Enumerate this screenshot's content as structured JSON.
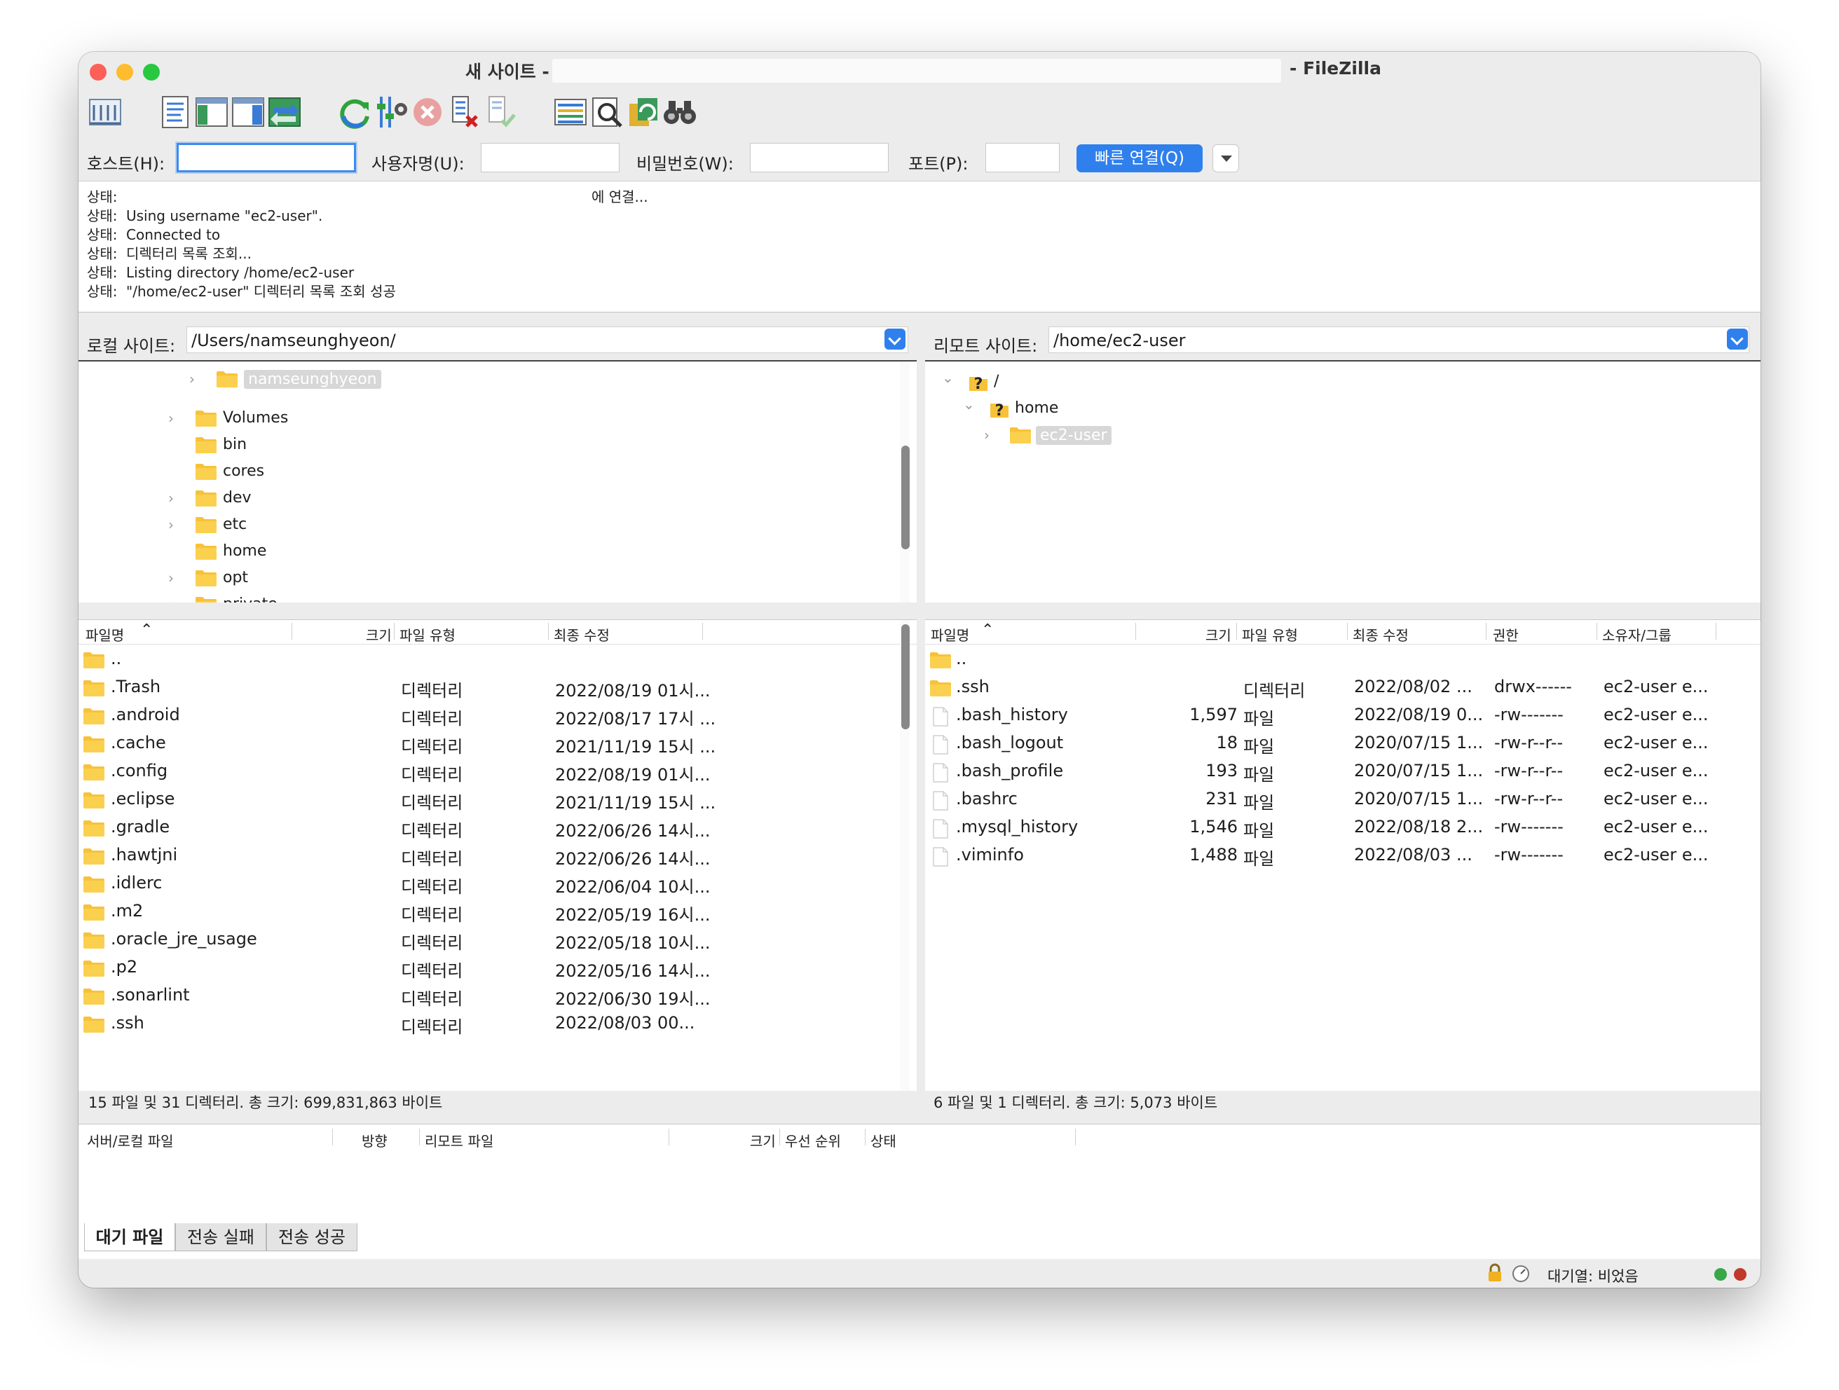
{
  "window": {
    "title_prefix": "새 사이트 -",
    "title_suffix": "- FileZilla"
  },
  "toolbar": {
    "icons": [
      "site-manager-icon",
      "message-log-icon",
      "local-tree-icon",
      "remote-tree-icon",
      "transfer-queue-icon",
      "refresh-icon",
      "filter-settings-icon",
      "cancel-icon",
      "disconnect-icon",
      "reconnect-icon",
      "directory-compare-icon",
      "search-files-icon",
      "sync-browse-icon",
      "find-binoculars-icon"
    ]
  },
  "quickconnect": {
    "host_label": "호스트(H):",
    "host_value": "",
    "user_label": "사용자명(U):",
    "user_value": "",
    "pass_label": "비밀번호(W):",
    "pass_value": "",
    "port_label": "포트(P):",
    "port_value": "",
    "connect_button": "빠른 연결(Q)"
  },
  "log": [
    {
      "prefix": "상태:",
      "text": "",
      "tail": "에 연결..."
    },
    {
      "prefix": "상태:",
      "text": "Using username \"ec2-user\".",
      "tail": ""
    },
    {
      "prefix": "상태:",
      "text": "Connected to",
      "tail": ""
    },
    {
      "prefix": "상태:",
      "text": "디렉터리 목록 조회...",
      "tail": ""
    },
    {
      "prefix": "상태:",
      "text": "Listing directory /home/ec2-user",
      "tail": ""
    },
    {
      "prefix": "상태:",
      "text": "\"/home/ec2-user\" 디렉터리 목록 조회 성공",
      "tail": ""
    }
  ],
  "local": {
    "site_label": "로컬 사이트:",
    "path": "/Users/namseunghyeon/",
    "tree": [
      {
        "name": "namseunghyeon",
        "expandable": true,
        "selected": true,
        "indent": 1
      },
      {
        "name": "Volumes",
        "expandable": true,
        "selected": false,
        "indent": 0
      },
      {
        "name": "bin",
        "expandable": false,
        "selected": false,
        "indent": 0
      },
      {
        "name": "cores",
        "expandable": false,
        "selected": false,
        "indent": 0
      },
      {
        "name": "dev",
        "expandable": true,
        "selected": false,
        "indent": 0
      },
      {
        "name": "etc",
        "expandable": true,
        "selected": false,
        "indent": 0
      },
      {
        "name": "home",
        "expandable": false,
        "selected": false,
        "indent": 0
      },
      {
        "name": "opt",
        "expandable": true,
        "selected": false,
        "indent": 0
      },
      {
        "name": "private",
        "expandable": true,
        "selected": false,
        "indent": 0
      }
    ],
    "columns": [
      "파일명",
      "크기",
      "파일 유형",
      "최종 수정"
    ],
    "files": [
      {
        "name": "..",
        "size": "",
        "type": "",
        "modified": ""
      },
      {
        "name": ".Trash",
        "size": "",
        "type": "디렉터리",
        "modified": "2022/08/19 01시..."
      },
      {
        "name": ".android",
        "size": "",
        "type": "디렉터리",
        "modified": "2022/08/17 17시 ..."
      },
      {
        "name": ".cache",
        "size": "",
        "type": "디렉터리",
        "modified": "2021/11/19 15시 ..."
      },
      {
        "name": ".config",
        "size": "",
        "type": "디렉터리",
        "modified": "2022/08/19 01시..."
      },
      {
        "name": ".eclipse",
        "size": "",
        "type": "디렉터리",
        "modified": "2021/11/19 15시 ..."
      },
      {
        "name": ".gradle",
        "size": "",
        "type": "디렉터리",
        "modified": "2022/06/26 14시..."
      },
      {
        "name": ".hawtjni",
        "size": "",
        "type": "디렉터리",
        "modified": "2022/06/26 14시..."
      },
      {
        "name": ".idlerc",
        "size": "",
        "type": "디렉터리",
        "modified": "2022/06/04 10시..."
      },
      {
        "name": ".m2",
        "size": "",
        "type": "디렉터리",
        "modified": "2022/05/19 16시..."
      },
      {
        "name": ".oracle_jre_usage",
        "size": "",
        "type": "디렉터리",
        "modified": "2022/05/18 10시..."
      },
      {
        "name": ".p2",
        "size": "",
        "type": "디렉터리",
        "modified": "2022/05/16 14시..."
      },
      {
        "name": ".sonarlint",
        "size": "",
        "type": "디렉터리",
        "modified": "2022/06/30 19시..."
      },
      {
        "name": ".ssh",
        "size": "",
        "type": "디렉터리",
        "modified": "2022/08/03 00..."
      }
    ],
    "status": "15 파일 및 31 디렉터리. 총 크기: 699,831,863 바이트"
  },
  "remote": {
    "site_label": "리모트 사이트:",
    "path": "/home/ec2-user",
    "tree": [
      {
        "name": "/",
        "kind": "unknown",
        "expanded": true,
        "indent": 0,
        "selected": false
      },
      {
        "name": "home",
        "kind": "unknown",
        "expanded": true,
        "indent": 1,
        "selected": false
      },
      {
        "name": "ec2-user",
        "kind": "folder",
        "expanded": false,
        "indent": 2,
        "selected": true
      }
    ],
    "columns": [
      "파일명",
      "크기",
      "파일 유형",
      "최종 수정",
      "권한",
      "소유자/그룹"
    ],
    "files": [
      {
        "name": "..",
        "kind": "folder",
        "size": "",
        "type": "",
        "modified": "",
        "perm": "",
        "owner": ""
      },
      {
        "name": ".ssh",
        "kind": "folder",
        "size": "",
        "type": "디렉터리",
        "modified": "2022/08/02 ...",
        "perm": "drwx------",
        "owner": "ec2-user e..."
      },
      {
        "name": ".bash_history",
        "kind": "file",
        "size": "1,597",
        "type": "파일",
        "modified": "2022/08/19 0...",
        "perm": "-rw-------",
        "owner": "ec2-user e..."
      },
      {
        "name": ".bash_logout",
        "kind": "file",
        "size": "18",
        "type": "파일",
        "modified": "2020/07/15 1...",
        "perm": "-rw-r--r--",
        "owner": "ec2-user e..."
      },
      {
        "name": ".bash_profile",
        "kind": "file",
        "size": "193",
        "type": "파일",
        "modified": "2020/07/15 1...",
        "perm": "-rw-r--r--",
        "owner": "ec2-user e..."
      },
      {
        "name": ".bashrc",
        "kind": "file",
        "size": "231",
        "type": "파일",
        "modified": "2020/07/15 1...",
        "perm": "-rw-r--r--",
        "owner": "ec2-user e..."
      },
      {
        "name": ".mysql_history",
        "kind": "file",
        "size": "1,546",
        "type": "파일",
        "modified": "2022/08/18 2...",
        "perm": "-rw-------",
        "owner": "ec2-user e..."
      },
      {
        "name": ".viminfo",
        "kind": "file",
        "size": "1,488",
        "type": "파일",
        "modified": "2022/08/03 ...",
        "perm": "-rw-------",
        "owner": "ec2-user e..."
      }
    ],
    "status": "6 파일 및 1 디렉터리. 총 크기: 5,073 바이트"
  },
  "queue": {
    "columns": [
      "서버/로컬 파일",
      "방향",
      "리모트 파일",
      "크기",
      "우선 순위",
      "상태"
    ],
    "tabs": [
      "대기 파일",
      "전송 실패",
      "전송 성공"
    ],
    "active_tab": 0,
    "status_text": "대기열: 비었음"
  },
  "colors": {
    "accent": "#2f80ed",
    "folder": "#f7c23a",
    "close": "#fe5f57",
    "minimize": "#febc2e",
    "zoom": "#28c840",
    "led_green": "#3aa64a",
    "led_red": "#c0392b"
  }
}
